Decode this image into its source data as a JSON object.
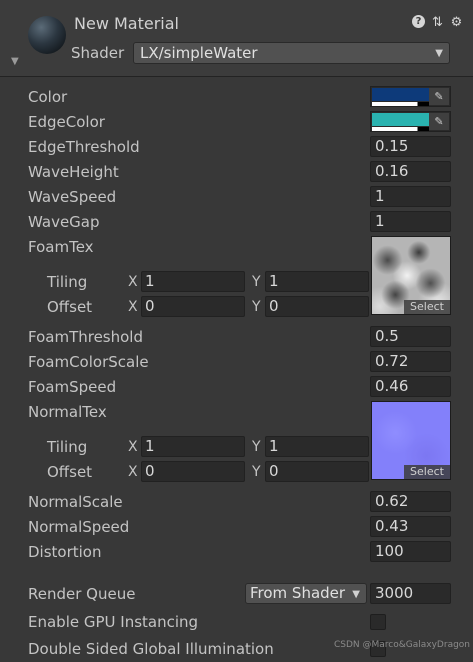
{
  "header": {
    "material_name": "New Material",
    "shader_label": "Shader",
    "shader_value": "LX/simpleWater"
  },
  "properties": {
    "color": {
      "label": "Color",
      "value": "#0d3a7a"
    },
    "edge_color": {
      "label": "EdgeColor",
      "value": "#2ab3b0"
    },
    "edge_threshold": {
      "label": "EdgeThreshold",
      "value": "0.15"
    },
    "wave_height": {
      "label": "WaveHeight",
      "value": "0.16"
    },
    "wave_speed": {
      "label": "WaveSpeed",
      "value": "1"
    },
    "wave_gap": {
      "label": "WaveGap",
      "value": "1"
    },
    "foam_tex": {
      "label": "FoamTex",
      "tiling_label": "Tiling",
      "offset_label": "Offset",
      "tiling_x": "1",
      "tiling_y": "1",
      "offset_x": "0",
      "offset_y": "0",
      "select_label": "Select"
    },
    "foam_threshold": {
      "label": "FoamThreshold",
      "value": "0.5"
    },
    "foam_color_scale": {
      "label": "FoamColorScale",
      "value": "0.72"
    },
    "foam_speed": {
      "label": "FoamSpeed",
      "value": "0.46"
    },
    "normal_tex": {
      "label": "NormalTex",
      "tiling_label": "Tiling",
      "offset_label": "Offset",
      "tiling_x": "1",
      "tiling_y": "1",
      "offset_x": "0",
      "offset_y": "0",
      "select_label": "Select"
    },
    "normal_scale": {
      "label": "NormalScale",
      "value": "0.62"
    },
    "normal_speed": {
      "label": "NormalSpeed",
      "value": "0.43"
    },
    "distortion": {
      "label": "Distortion",
      "value": "100"
    }
  },
  "axis": {
    "x": "X",
    "y": "Y"
  },
  "render_queue": {
    "label": "Render Queue",
    "mode": "From Shader",
    "value": "3000"
  },
  "gpu_instancing": {
    "label": "Enable GPU Instancing",
    "checked": false
  },
  "double_sided_gi": {
    "label": "Double Sided Global Illumination",
    "checked": false
  },
  "watermark": "CSDN @Marco&GalaxyDragon",
  "colors": {
    "accent": "#2ab3b0",
    "background": "#383838"
  }
}
